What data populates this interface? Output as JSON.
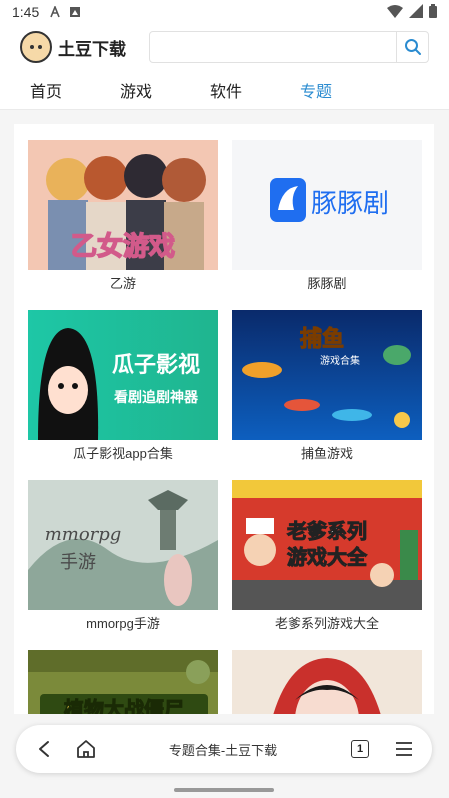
{
  "status_bar": {
    "time": "1:45",
    "icons": [
      "a-notification-icon",
      "photo-notification-icon"
    ],
    "right_icons": [
      "wifi-icon",
      "signal-icon",
      "battery-icon"
    ]
  },
  "header": {
    "logo_text": "土豆下载",
    "search_placeholder": ""
  },
  "tabs": [
    {
      "label": "首页",
      "active": false
    },
    {
      "label": "游戏",
      "active": false
    },
    {
      "label": "软件",
      "active": false
    },
    {
      "label": "专题",
      "active": true
    }
  ],
  "cards": [
    {
      "label": "乙游",
      "thumb_text": "乙女游戏"
    },
    {
      "label": "豚豚剧",
      "thumb_text": "豚豚剧"
    },
    {
      "label": "瓜子影视app合集",
      "thumb_text": "瓜子影视",
      "thumb_sub": "看剧追剧神器"
    },
    {
      "label": "捕鱼游戏",
      "thumb_text": "捕鱼",
      "thumb_sub": "游戏合集"
    },
    {
      "label": "mmorpg手游",
      "thumb_text": "mmorpg",
      "thumb_sub": "手游"
    },
    {
      "label": "老爹系列游戏大全",
      "thumb_text": "老爹系列",
      "thumb_sub": "游戏大全"
    },
    {
      "label": "",
      "thumb_text": "植物大战僵尸"
    },
    {
      "label": "",
      "thumb_text": ""
    }
  ],
  "bottom_bar": {
    "title": "专题合集-土豆下载",
    "tab_count": "1"
  },
  "colors": {
    "accent": "#2a8bd0"
  }
}
